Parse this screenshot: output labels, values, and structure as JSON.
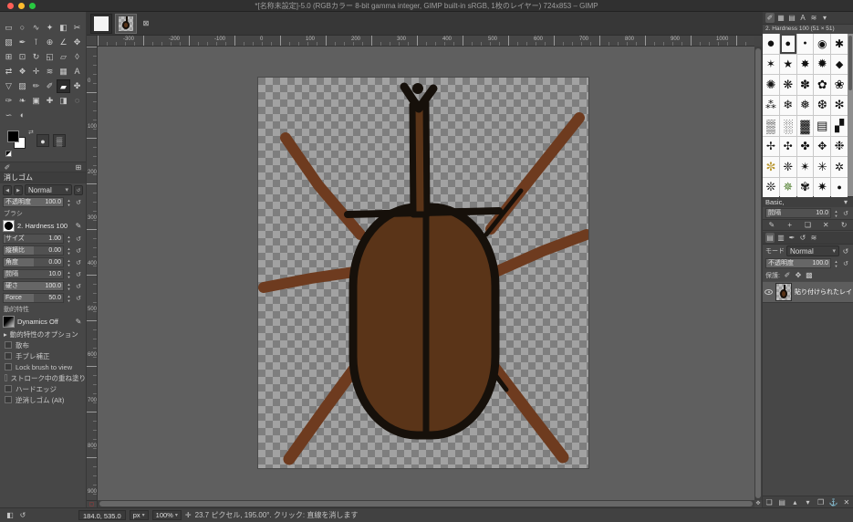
{
  "titlebar": {
    "title": "*[名称未設定]-5.0 (RGBカラー 8-bit gamma integer, GIMP built-in sRGB, 1枚のレイヤー) 724x853 – GIMP"
  },
  "icons": {
    "swap": "⇄",
    "tool_options_tab": "✐",
    "dock_menu": "⊞",
    "back": "◀",
    "forward": "▶",
    "dropdown": "▾",
    "reset": "↺",
    "edit": "✎",
    "expander": "▸",
    "close_box": "⊠",
    "nav": "✥",
    "status": "✛",
    "sb1": "◧",
    "sb2": "↺",
    "quickmask": "▢"
  },
  "toolbox": {
    "tools": [
      {
        "name": "rect-select",
        "glyph": "▭"
      },
      {
        "name": "ellipse-select",
        "glyph": "○"
      },
      {
        "name": "free-select",
        "glyph": "∿"
      },
      {
        "name": "fuzzy-select",
        "glyph": "✦"
      },
      {
        "name": "select-by-color",
        "glyph": "◧"
      },
      {
        "name": "scissors-select",
        "glyph": "✂"
      },
      {
        "name": "foreground-select",
        "glyph": "▧"
      },
      {
        "name": "paths",
        "glyph": "✒"
      },
      {
        "name": "color-picker",
        "glyph": "⊺"
      },
      {
        "name": "zoom",
        "glyph": "⊕"
      },
      {
        "name": "measure",
        "glyph": "∠"
      },
      {
        "name": "move",
        "glyph": "✥"
      },
      {
        "name": "align",
        "glyph": "⊞"
      },
      {
        "name": "crop",
        "glyph": "⊡"
      },
      {
        "name": "rotate",
        "glyph": "↻"
      },
      {
        "name": "scale",
        "glyph": "◱"
      },
      {
        "name": "shear",
        "glyph": "▱"
      },
      {
        "name": "perspective",
        "glyph": "◊"
      },
      {
        "name": "flip",
        "glyph": "⇄"
      },
      {
        "name": "unified-transform",
        "glyph": "❖"
      },
      {
        "name": "handle-transform",
        "glyph": "✛"
      },
      {
        "name": "warp-transform",
        "glyph": "≋"
      },
      {
        "name": "cage-transform",
        "glyph": "▦"
      },
      {
        "name": "text",
        "glyph": "A"
      },
      {
        "name": "bucket-fill",
        "glyph": "▽"
      },
      {
        "name": "gradient",
        "glyph": "▨"
      },
      {
        "name": "pencil",
        "glyph": "✏"
      },
      {
        "name": "paintbrush",
        "glyph": "✐"
      },
      {
        "name": "eraser",
        "glyph": "▰",
        "active": true
      },
      {
        "name": "airbrush",
        "glyph": "✤"
      },
      {
        "name": "ink",
        "glyph": "✑"
      },
      {
        "name": "mypaint-brush",
        "glyph": "❧"
      },
      {
        "name": "clone",
        "glyph": "▣"
      },
      {
        "name": "heal",
        "glyph": "✚"
      },
      {
        "name": "perspective-clone",
        "glyph": "◨"
      },
      {
        "name": "blur-sharpen",
        "glyph": "◌"
      },
      {
        "name": "smudge",
        "glyph": "∽"
      },
      {
        "name": "dodge-burn",
        "glyph": "◐"
      }
    ]
  },
  "color_selector": {
    "fg": "#000000",
    "bg": "#ffffff"
  },
  "tool_options": {
    "title": "消しゴム",
    "mode": {
      "value": "Normal"
    },
    "opacity": {
      "label": "不透明度",
      "value": "100.0",
      "fill": 1
    },
    "brush": {
      "label": "ブラシ",
      "name": "2. Hardness 100"
    },
    "sliders": [
      {
        "label": "サイズ",
        "value": "1.00",
        "fill": 0.03
      },
      {
        "label": "縦横比",
        "value": "0.00",
        "fill": 0.5
      },
      {
        "label": "角度",
        "value": "0.00",
        "fill": 0.5
      },
      {
        "label": "間隔",
        "value": "10.0",
        "fill": 0.06
      },
      {
        "label": "硬さ",
        "value": "100.0",
        "fill": 1
      },
      {
        "label": "Force",
        "value": "50.0",
        "fill": 0.5
      }
    ],
    "dynamics": {
      "label": "動的特性",
      "name": "Dynamics Off"
    },
    "expander_label": "動的特性のオプション",
    "checkboxes": [
      {
        "label": "散布"
      },
      {
        "label": "手ブレ補正"
      },
      {
        "label": "Lock brush to view"
      },
      {
        "label": "ストローク中の重ね塗り"
      },
      {
        "label": "ハードエッジ"
      },
      {
        "label": "逆消しゴム (Alt)"
      }
    ]
  },
  "canvas": {
    "tabs": [
      {
        "name": "blank",
        "beetle": false,
        "active": false
      },
      {
        "name": "beetle",
        "beetle": true,
        "active": true
      }
    ],
    "ruler_top_labels": [
      "-300",
      "-200",
      "-100",
      "0",
      "100",
      "200",
      "300",
      "400",
      "500",
      "600",
      "700",
      "800",
      "900",
      "1000"
    ],
    "ruler_left_labels": [
      "0",
      "100",
      "200",
      "300",
      "400",
      "500",
      "600",
      "700",
      "800",
      "900"
    ],
    "colors": {
      "body": "#5a3418",
      "legs": "#6e3b1f",
      "outline": "#16100a"
    }
  },
  "brushes_dock": {
    "tabs": [
      "✐",
      "▦",
      "▤",
      "A",
      "≋",
      "▾"
    ],
    "header": "2. Hardness 100 (51 × 51)",
    "selected_index": 1,
    "cells": [
      {
        "g": "●",
        "s": 15
      },
      {
        "g": "●",
        "s": 11
      },
      {
        "g": "●",
        "s": 7
      },
      {
        "g": "◉",
        "s": 12
      },
      {
        "g": "✱",
        "s": 12
      },
      {
        "g": "✶",
        "s": 12
      },
      {
        "g": "★",
        "s": 12
      },
      {
        "g": "✸",
        "s": 12
      },
      {
        "g": "✹",
        "s": 13
      },
      {
        "g": "◆",
        "s": 11
      },
      {
        "g": "✺",
        "s": 13
      },
      {
        "g": "❋",
        "s": 13
      },
      {
        "g": "✽",
        "s": 13
      },
      {
        "g": "✿",
        "s": 13
      },
      {
        "g": "❀",
        "s": 13
      },
      {
        "g": "⁂",
        "s": 12
      },
      {
        "g": "❄",
        "s": 13
      },
      {
        "g": "❅",
        "s": 13
      },
      {
        "g": "❆",
        "s": 13
      },
      {
        "g": "✻",
        "s": 13
      },
      {
        "g": "▒",
        "s": 14
      },
      {
        "g": "░",
        "s": 14
      },
      {
        "g": "▓",
        "s": 14
      },
      {
        "g": "▤",
        "s": 13
      },
      {
        "g": "▞",
        "s": 13
      },
      {
        "g": "✢",
        "s": 12
      },
      {
        "g": "✣",
        "s": 12
      },
      {
        "g": "✤",
        "s": 12
      },
      {
        "g": "✥",
        "s": 12
      },
      {
        "g": "❉",
        "s": 13
      },
      {
        "g": "✼",
        "s": 13,
        "c": "#b8962e"
      },
      {
        "g": "❈",
        "s": 13
      },
      {
        "g": "✴",
        "s": 13
      },
      {
        "g": "✳",
        "s": 13
      },
      {
        "g": "✲",
        "s": 12
      },
      {
        "g": "❊",
        "s": 13
      },
      {
        "g": "✵",
        "s": 13,
        "c": "#4e7d2c"
      },
      {
        "g": "✾",
        "s": 13
      },
      {
        "g": "✷",
        "s": 13
      },
      {
        "g": "●",
        "s": 9
      }
    ],
    "group_label": "Basic,",
    "spacing": {
      "label": "間隔",
      "value": "10.0",
      "fill": 0.06
    },
    "actions": [
      "✎",
      "+",
      "❏",
      "✕",
      "↻"
    ]
  },
  "layers_dock": {
    "tabs": [
      "▤",
      "▥",
      "✒",
      "↺",
      "≋"
    ],
    "mode": {
      "label": "モード",
      "value": "Normal"
    },
    "opacity": {
      "label": "不透明度",
      "value": "100.0",
      "fill": 1
    },
    "lock": {
      "label": "保護:",
      "icons": [
        "✐",
        "✥",
        "▩"
      ]
    },
    "layer": {
      "name": "貼り付けられたレイヤー"
    },
    "footer": [
      "❏",
      "▤",
      "▴",
      "▾",
      "❐",
      "⚓",
      "✕"
    ]
  },
  "statusbar": {
    "position": "184.0, 535.0",
    "unit": "px",
    "zoom": "100%",
    "message": "23.7 ピクセル, 195.00°. クリック: 直線を消します"
  }
}
